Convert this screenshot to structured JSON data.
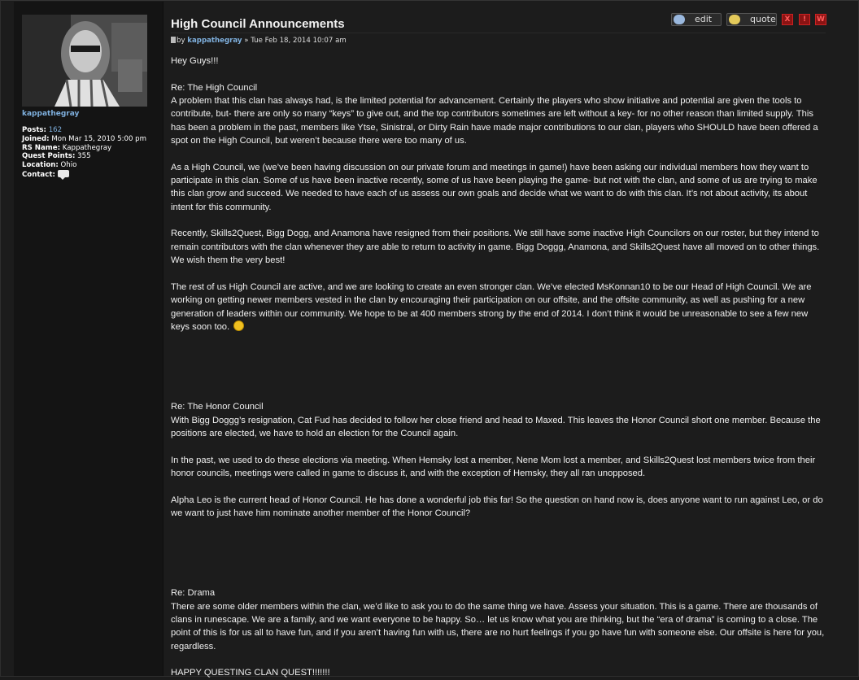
{
  "profile": {
    "username": "kappathegray",
    "posts_label": "Posts:",
    "posts_value": "162",
    "joined_label": "Joined:",
    "joined_value": "Mon Mar 15, 2010 5:00 pm",
    "rsname_label": "RS Name:",
    "rsname_value": "Kappathegray",
    "quest_label": "Quest Points:",
    "quest_value": "355",
    "location_label": "Location:",
    "location_value": "Ohio",
    "contact_label": "Contact:",
    "contact_icon": "message-icon"
  },
  "post": {
    "title": "High Council Announcements",
    "by_label": "by",
    "author": "kappathegray",
    "separator": "»",
    "date": "Tue Feb 18, 2014 10:07 am",
    "buttons": {
      "edit": "edit",
      "quote": "quote",
      "delete": "X",
      "report": "!",
      "warn": "W"
    },
    "paragraphs": {
      "greeting": "Hey Guys!!!",
      "h1": "Re: The High Council",
      "p1": "A problem that this clan has always had, is the limited potential for advancement. Certainly the players who show initiative and potential are given the tools to contribute, but- there are only so many “keys” to give out, and the top contributors sometimes are left without a key- for no other reason than limited supply. This has been a problem in the past, members like Ytse, Sinistral, or Dirty Rain have made major contributions to our clan, players who SHOULD have been offered a spot on the High Council, but weren’t because there were too many of us.",
      "p2": "As a High Council, we (we’ve been having discussion on our private forum and meetings in game!) have been asking our individual members how they want to participate in this clan. Some of us have been inactive recently, some of us have been playing the game- but not with the clan, and some of us are trying to make this clan grow and succeed. We needed to have each of us assess our own goals and decide what we want to do with this clan. It’s not about activity, its about intent for this community.",
      "p3": "Recently, Skills2Quest, Bigg Dogg, and Anamona have resigned from their positions. We still have some inactive High Councilors on our roster, but they intend to remain contributors with the clan whenever they are able to return to activity in game. Bigg Doggg, Anamona, and Skills2Quest have all moved on to other things. We wish them the very best!",
      "p4": "The rest of us High Council are active, and we are looking to create an even stronger clan. We’ve elected MsKonnan10 to be our Head of High Council. We are working on getting newer members vested in the clan by encouraging their participation on our offsite, and the offsite community, as well as pushing for a new generation of leaders within our community. We hope to be at 400 members strong by the end of 2014. I don’t think it would be unreasonable to see a few new keys soon too.",
      "h2": "Re: The Honor Council",
      "p5": "With Bigg Doggg’s resignation, Cat Fud has decided to follow her close friend and head to Maxed. This leaves the Honor Council short one member. Because the positions are elected, we have to hold an election for the Council again.",
      "p6": "In the past, we used to do these elections via meeting. When Hemsky lost a member, Nene Mom lost a member, and Skills2Quest lost members twice from their honor councils, meetings were called in game to discuss it, and with the exception of Hemsky, they all ran unopposed.",
      "p7": "Alpha Leo is the current head of Honor Council. He has done a wonderful job this far! So the question on hand now is, does anyone want to run against Leo, or do we want to just have him nominate another member of the Honor Council?",
      "h3": "Re: Drama",
      "p8": "There are some older members within the clan, we’d like to ask you to do the same thing we have. Assess your situation. This is a game. There are thousands of clans in runescape. We are a family, and we want everyone to be happy. So… let us know what you are thinking, but the “era of drama” is coming to a close. The point of this is for us all to have fun, and if you aren’t having fun with us, there are no hurt feelings if you go have fun with someone else. Our offsite is here for you, regardless.",
      "closing": "HAPPY QUESTING CLAN QUEST!!!!!!!"
    },
    "smiley": "wink-smiley-icon"
  }
}
